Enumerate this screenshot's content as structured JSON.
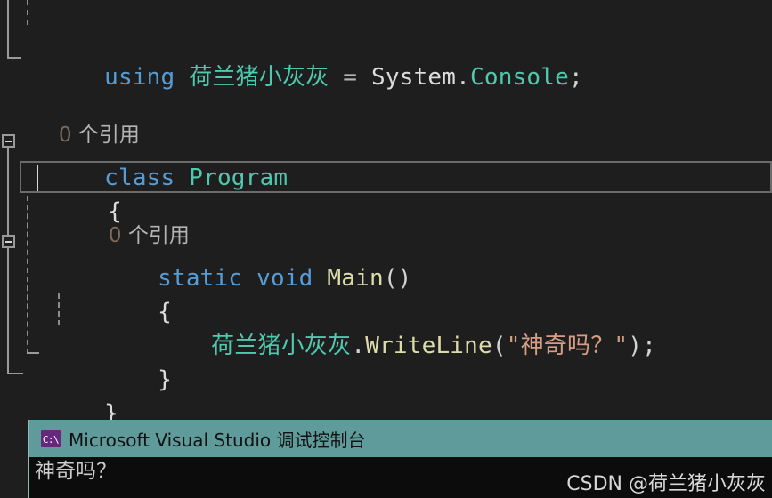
{
  "editor": {
    "language": "csharp",
    "theme_background": "#1e1e1e",
    "lines": [
      {
        "kind": "code",
        "tokens": [
          {
            "text": "using ",
            "role": "keyword"
          },
          {
            "text": "荷兰猪小灰灰",
            "role": "type"
          },
          {
            "text": " = ",
            "role": "operator"
          },
          {
            "text": "System",
            "role": "identifier"
          },
          {
            "text": ".",
            "role": "punctuation"
          },
          {
            "text": "Console",
            "role": "type"
          },
          {
            "text": ";",
            "role": "punctuation"
          }
        ]
      },
      {
        "kind": "codelens",
        "count": "0",
        "label": " 个引用"
      },
      {
        "kind": "code",
        "tokens": [
          {
            "text": "class ",
            "role": "keyword"
          },
          {
            "text": "Program",
            "role": "type"
          }
        ]
      },
      {
        "kind": "code",
        "tokens": [
          {
            "text": "{",
            "role": "brace"
          }
        ]
      },
      {
        "kind": "codelens",
        "count": "0",
        "label": " 个引用"
      },
      {
        "kind": "code",
        "tokens": [
          {
            "text": "static ",
            "role": "keyword"
          },
          {
            "text": "void ",
            "role": "keyword"
          },
          {
            "text": "Main",
            "role": "method"
          },
          {
            "text": "()",
            "role": "punctuation"
          }
        ]
      },
      {
        "kind": "code",
        "tokens": [
          {
            "text": "{",
            "role": "brace"
          }
        ]
      },
      {
        "kind": "code",
        "tokens": [
          {
            "text": "荷兰猪小灰灰",
            "role": "type"
          },
          {
            "text": ".",
            "role": "punctuation"
          },
          {
            "text": "WriteLine",
            "role": "method"
          },
          {
            "text": "(",
            "role": "punctuation"
          },
          {
            "text": "\"神奇吗？\"",
            "role": "string"
          },
          {
            "text": ")",
            "role": "punctuation"
          },
          {
            "text": ";",
            "role": "punctuation"
          }
        ]
      },
      {
        "kind": "code",
        "tokens": [
          {
            "text": "}",
            "role": "brace"
          }
        ]
      },
      {
        "kind": "code",
        "tokens": [
          {
            "text": "}",
            "role": "brace"
          }
        ]
      }
    ],
    "outlining": {
      "class_region_collapsed": false,
      "method_region_collapsed": false,
      "collapse_glyph": "minus"
    }
  },
  "console": {
    "icon_name": "console-app-icon",
    "icon_glyph": "C:\\",
    "title": "Microsoft Visual Studio 调试控制台",
    "output": "神奇吗？"
  },
  "watermark": {
    "text": "CSDN @荷兰猪小灰灰"
  },
  "colors": {
    "editor_bg": "#1e1e1e",
    "keyword": "#569cd6",
    "type": "#4ec9b0",
    "method": "#dcdcaa",
    "string": "#d69d85",
    "identifier": "#dcdcdc",
    "codelens": "#b4b4b4",
    "console_titlebar": "#5f9b9b",
    "console_bg": "#0c0c0c"
  }
}
